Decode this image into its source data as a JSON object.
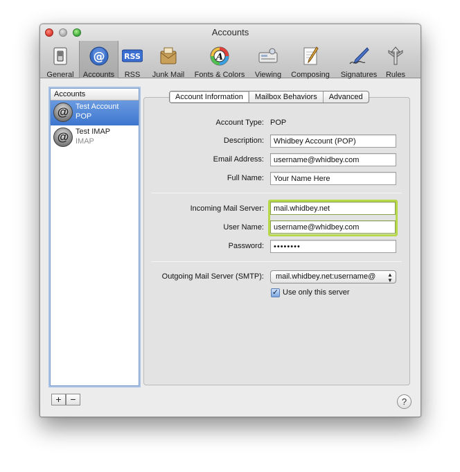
{
  "window": {
    "title": "Accounts"
  },
  "toolbar": {
    "items": [
      {
        "label": "General",
        "icon": "switch-icon"
      },
      {
        "label": "Accounts",
        "icon": "at-sign-icon",
        "selected": true
      },
      {
        "label": "RSS",
        "icon": "rss-icon"
      },
      {
        "label": "Junk Mail",
        "icon": "junk-mail-icon"
      },
      {
        "label": "Fonts & Colors",
        "icon": "fonts-colors-icon"
      },
      {
        "label": "Viewing",
        "icon": "viewing-icon"
      },
      {
        "label": "Composing",
        "icon": "composing-icon"
      },
      {
        "label": "Signatures",
        "icon": "signatures-icon"
      },
      {
        "label": "Rules",
        "icon": "rules-icon"
      }
    ]
  },
  "sidebar": {
    "header": "Accounts",
    "accounts": [
      {
        "name": "Test Account",
        "type": "POP",
        "selected": true,
        "icon": "at-sign-icon"
      },
      {
        "name": "Test IMAP",
        "type": "IMAP",
        "selected": false,
        "icon": "at-sign-icon"
      }
    ],
    "add_label": "+",
    "remove_label": "−"
  },
  "help": {
    "label": "?"
  },
  "tabs": [
    {
      "label": "Account Information",
      "active": true
    },
    {
      "label": "Mailbox Behaviors",
      "active": false
    },
    {
      "label": "Advanced",
      "active": false
    }
  ],
  "form": {
    "account_type_label": "Account Type:",
    "account_type_value": "POP",
    "description_label": "Description:",
    "description_value": "Whidbey Account (POP)",
    "email_label": "Email Address:",
    "email_value": "username@whidbey.com",
    "fullname_label": "Full Name:",
    "fullname_value": "Your Name Here",
    "incoming_label": "Incoming Mail Server:",
    "incoming_value": "mail.whidbey.net",
    "username_label": "User Name:",
    "username_value": "username@whidbey.com",
    "password_label": "Password:",
    "password_value": "••••••••",
    "smtp_label": "Outgoing Mail Server (SMTP):",
    "smtp_value": "mail.whidbey.net:username@",
    "use_only_label": "Use only this server",
    "use_only_checked": true
  },
  "colors": {
    "selection": "#3d76cf",
    "focus_highlight": "#b7d84a"
  }
}
